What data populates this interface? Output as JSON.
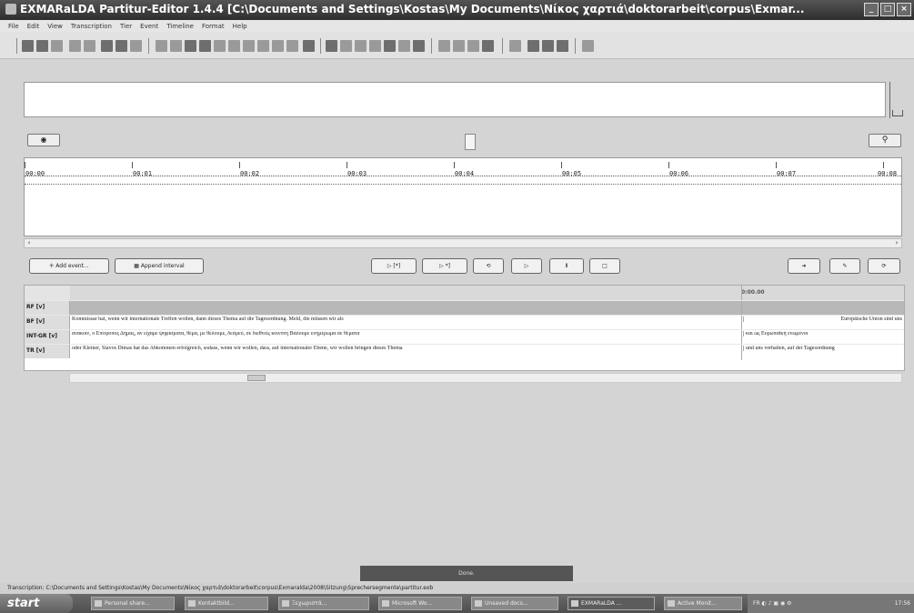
{
  "window": {
    "title": "EXMARaLDA Partitur-Editor 1.4.4 [C:\\Documents and Settings\\Kostas\\My Documents\\Νίκος χαρτιά\\doktorarbeit\\corpus\\Exmar..."
  },
  "menu": [
    "File",
    "Edit",
    "View",
    "Transcription",
    "Tier",
    "Event",
    "Timeline",
    "Format",
    "Help"
  ],
  "timeline": {
    "ticks": [
      "00:00",
      "00:01",
      "00:02",
      "00:03",
      "00:04",
      "00:05",
      "00:06",
      "00:07",
      "00:08"
    ]
  },
  "buttons": {
    "add_event": "Add event...",
    "append_interval": "Append interval"
  },
  "partitur": {
    "event_header": "0:00.00",
    "tiers": [
      {
        "label": "RF [v]",
        "text1": "",
        "text2": ""
      },
      {
        "label": "BF [v]",
        "text1": "Kommissar hat, wenn wir internationale Treffen wollen, dann dieses Thema auf die Tagesordnung. Meld, die müssen wir als",
        "text2": "Europäische Union sind uns"
      },
      {
        "label": "INT-GR [v]",
        "text1": "ανακοίν, ο Επίτροπος Δήμας, αν είχαμε ψηφίσματα, θέμα, με θέλουμε, δεσμεύ, σε διεθνείς κοινότη Βάλουμε ενημέρωμα σε θέματα",
        "text2": "και ως Ευρωπαϊκή ενωμένοι"
      },
      {
        "label": "TR [v]",
        "text1": "oder Kleiner, Slavos Dimas hat das Abkommen erfolgreich, sodass, wenn wir wollen, dass, auf internationaler Ebene, wir wollen bringen dieses Thema",
        "text2": "und uns verhalten, auf der Tagesordnung"
      }
    ]
  },
  "status": {
    "center": "Done.",
    "path": "Transcription: C:\\Documents and Settings\\Kostas\\My Documents\\Νίκος χαρτιά\\doktorarbeit\\corpus\\Exmaralda\\2008\\Sitzung\\Sprechersegmente\\partitur.exb"
  },
  "taskbar": {
    "start": "start",
    "tasks": [
      "Personal share...",
      "Kontaktbild...",
      "Ξεχωριστά...",
      "Microsoft Wo...",
      "Unsaved docs...",
      "EXMARaLDA ...",
      "Active Monit..."
    ],
    "tray": "FR",
    "clock": "17:56"
  }
}
